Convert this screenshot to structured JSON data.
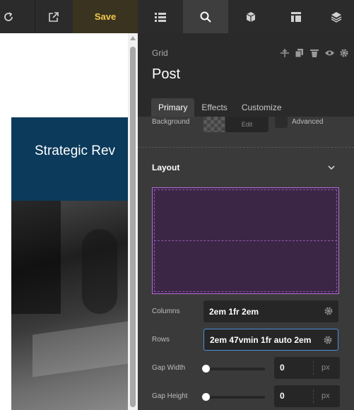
{
  "toolbar": {
    "save_label": "Save",
    "icons": [
      "refresh-icon",
      "external-link-icon",
      "list-icon",
      "search-icon",
      "cube-icon",
      "layout-icon",
      "layers-icon"
    ],
    "active_tab": "search"
  },
  "canvas": {
    "hero_text": "Strategic Rev"
  },
  "panel": {
    "breadcrumb": "Grid",
    "title": "Post",
    "header_icons": [
      "pin-icon",
      "copy-icon",
      "trash-icon",
      "eye-icon",
      "gear-icon"
    ],
    "tabs": [
      {
        "label": "Primary",
        "active": true
      },
      {
        "label": "Effects",
        "active": false
      },
      {
        "label": "Customize",
        "active": false
      }
    ],
    "background": {
      "label": "Background",
      "edit_label": "Edit",
      "advanced_label": "Advanced"
    },
    "layout": {
      "section_title": "Layout",
      "columns": {
        "label": "Columns",
        "value": "2em 1fr 2em"
      },
      "rows": {
        "label": "Rows",
        "value": "2em 47vmin 1fr auto 2em"
      },
      "gap_width": {
        "label": "Gap Width",
        "value": "0",
        "unit": "px"
      },
      "gap_height": {
        "label": "Gap Height",
        "value": "0",
        "unit": "px"
      }
    }
  },
  "colors": {
    "accent_save": "#f2c94c",
    "grid_outline": "#b36ed6",
    "focus": "#4a90d9",
    "hero_bg": "#0b3a5b"
  }
}
